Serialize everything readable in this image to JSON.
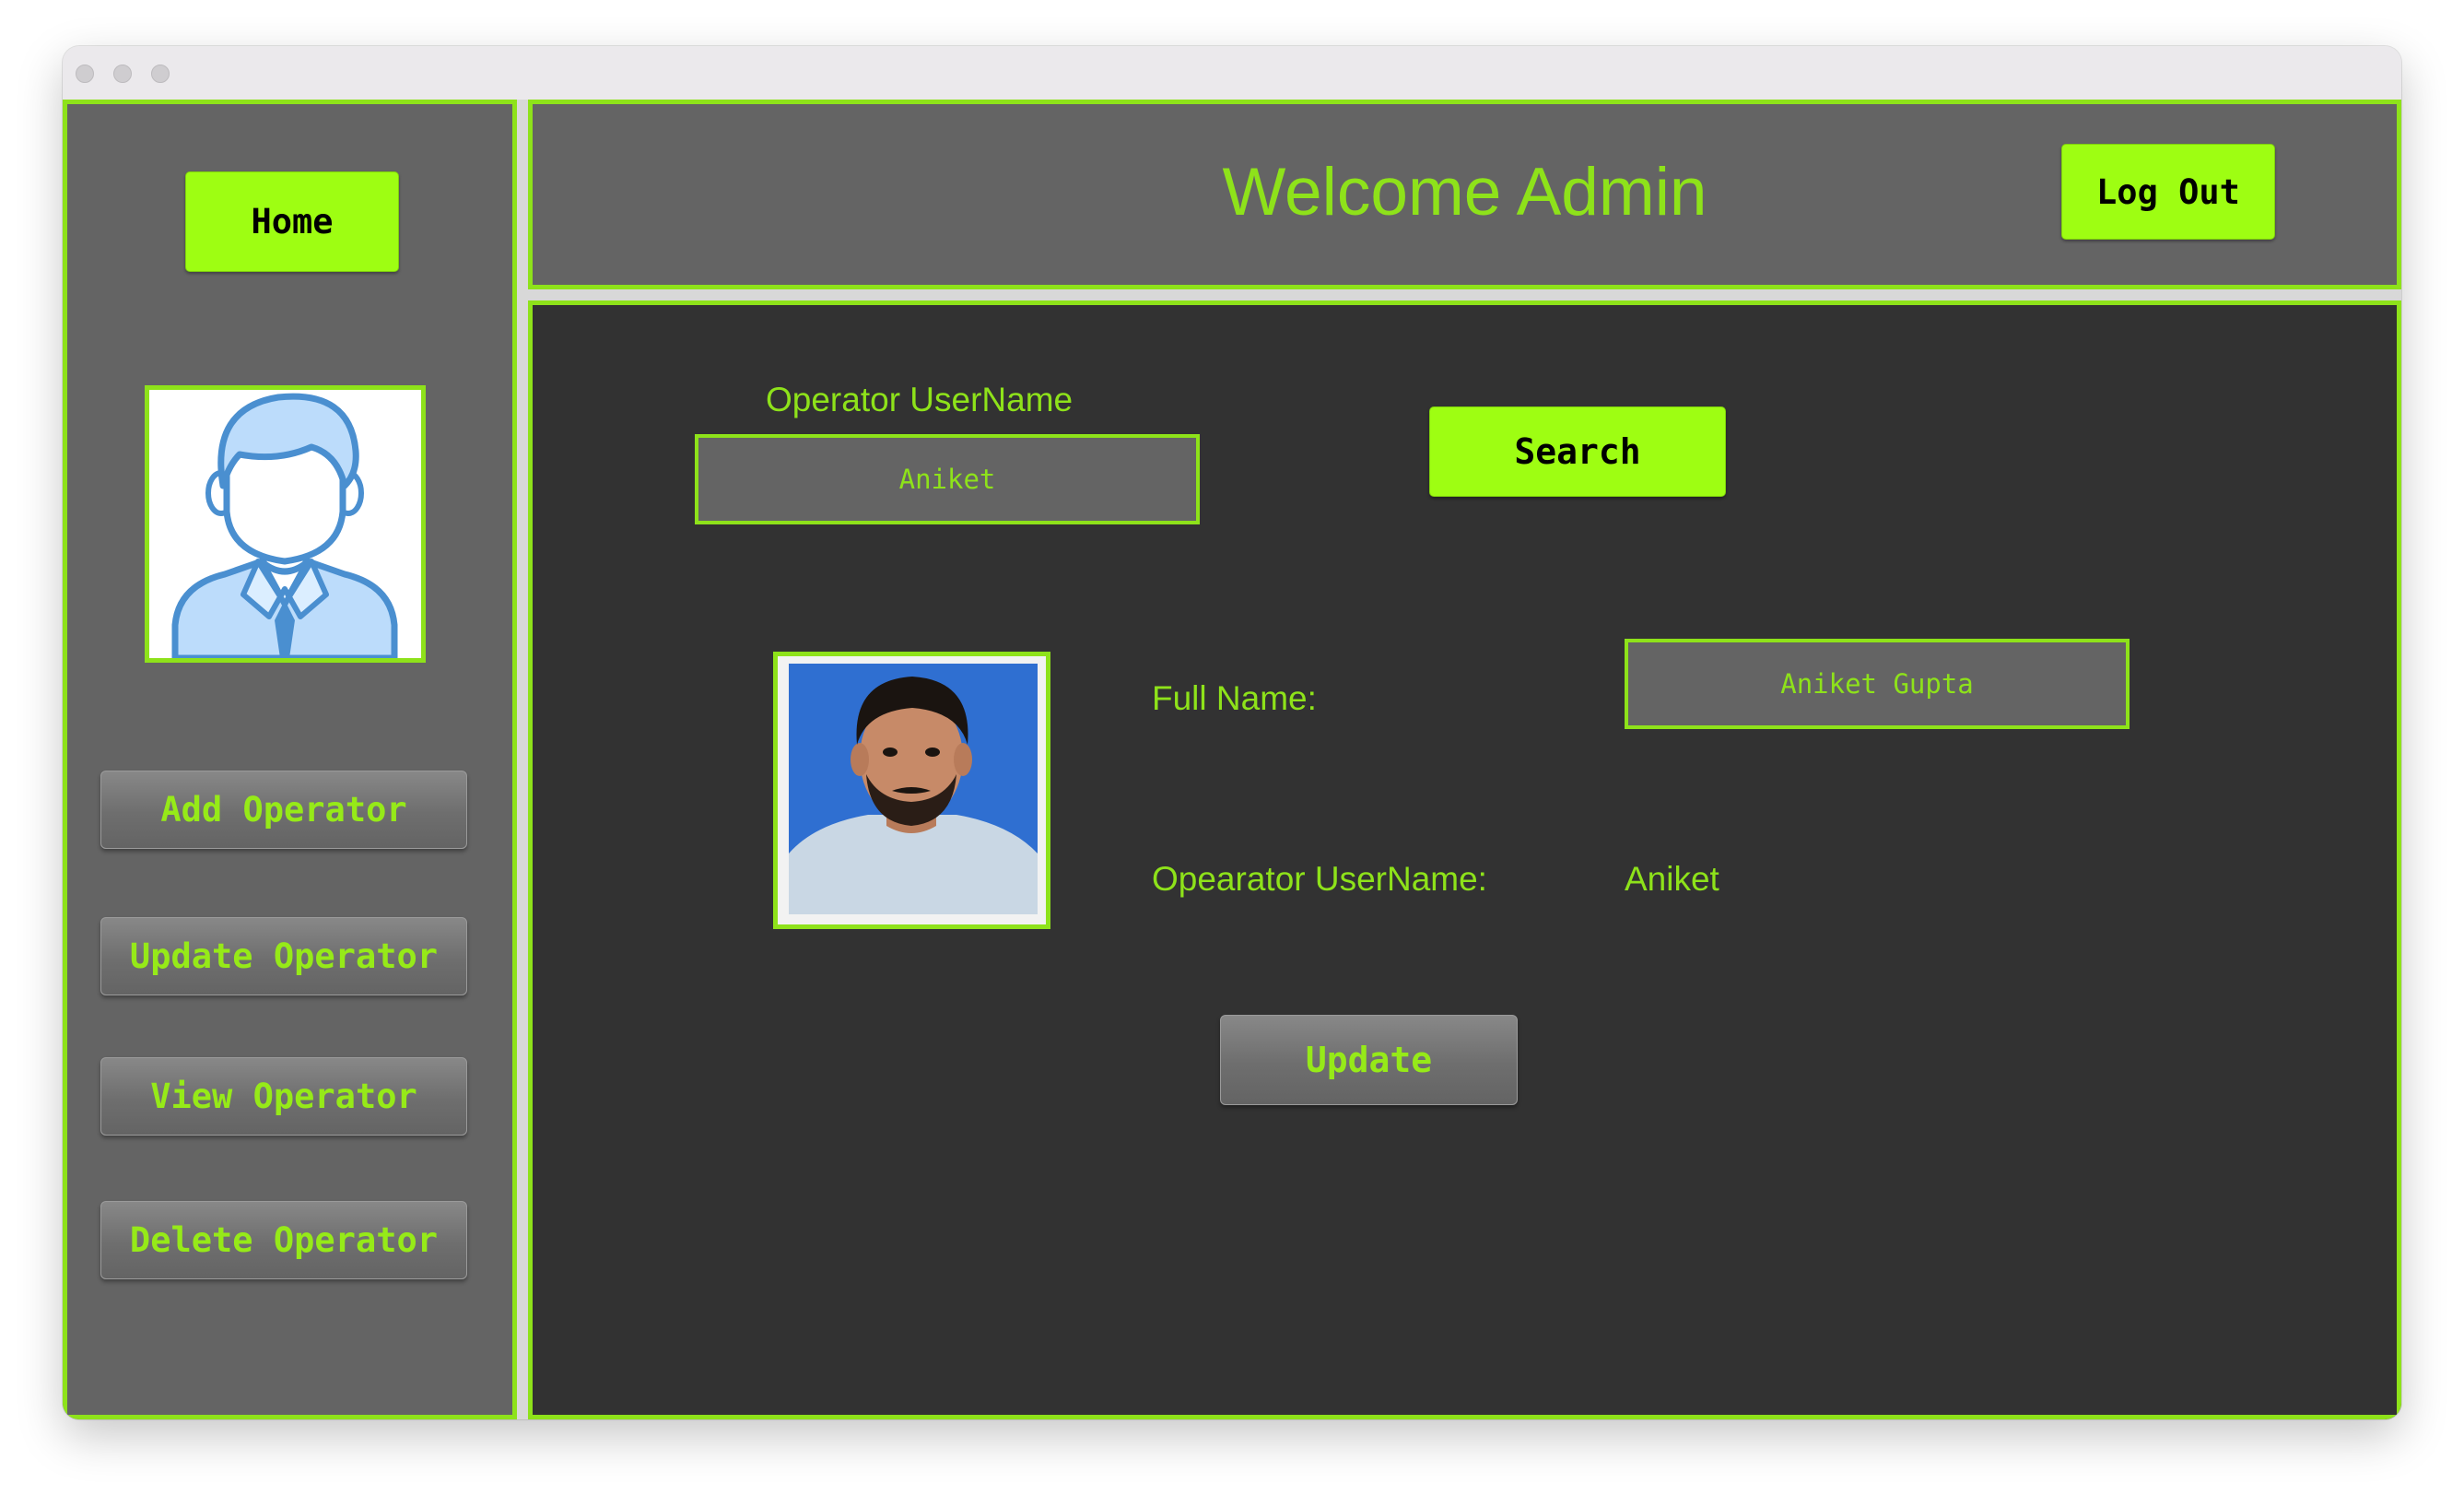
{
  "header": {
    "title": "Welcome Admin",
    "logout_label": "Log Out"
  },
  "sidebar": {
    "home_label": "Home",
    "items": [
      {
        "label": "Add Operator"
      },
      {
        "label": "Update Operator"
      },
      {
        "label": "View Operator"
      },
      {
        "label": "Delete Operator"
      }
    ]
  },
  "search": {
    "label": "Operator UserName",
    "value": "Aniket",
    "button_label": "Search"
  },
  "details": {
    "full_name_label": "Full Name:",
    "full_name_value": "Aniket Gupta",
    "username_label": "Opearator UserName:",
    "username_value": "Aniket",
    "update_label": "Update"
  },
  "colors": {
    "accent": "#8ee21a",
    "bright_button": "#9efe12",
    "panel": "#646464",
    "main_bg": "#323232"
  }
}
